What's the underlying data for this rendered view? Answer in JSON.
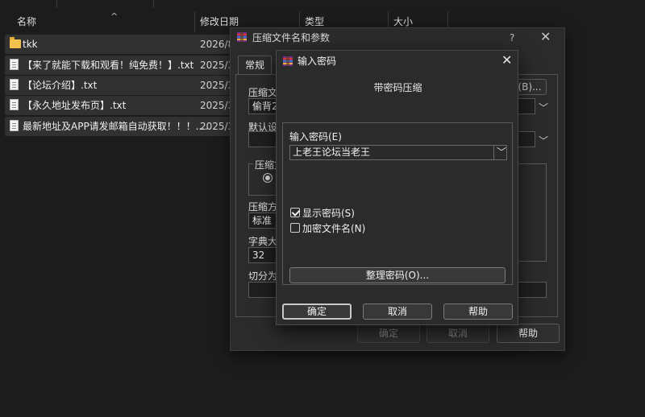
{
  "explorer": {
    "columns": {
      "name": "名称",
      "modified": "修改日期",
      "type": "类型",
      "size": "大小"
    },
    "sort_arrow": "^",
    "rows": [
      {
        "icon": "folder-icon",
        "name": "tkk",
        "date": "2026/8,"
      },
      {
        "icon": "txt-file-icon",
        "name": "【来了就能下载和观看！纯免费！】.txt",
        "date": "2025/3,"
      },
      {
        "icon": "txt-file-icon",
        "name": "【论坛介绍】.txt",
        "date": "2025/3,"
      },
      {
        "icon": "txt-file-icon",
        "name": "【永久地址发布页】.txt",
        "date": "2025/3,"
      },
      {
        "icon": "txt-file-icon",
        "name": "最新地址及APP请发邮箱自动获取！！！....",
        "date": "2025/3,"
      }
    ]
  },
  "archive_dialog": {
    "title": "压缩文件名和参数",
    "icon": "winrar-icon",
    "help_symbol": "?",
    "close_symbol": "✕",
    "tab_general": "常规",
    "archive_label": "压缩文",
    "archive_value": "偷背2",
    "browse_label": "(B)...",
    "default_label": "默认设",
    "format_label": "压缩文",
    "method_label": "压缩方",
    "method_value": "标准",
    "dict_label": "字典大",
    "dict_value": "32",
    "split_label": "切分为",
    "ok": "确定",
    "cancel": "取消",
    "help": "帮助"
  },
  "password_dialog": {
    "title": "输入密码",
    "icon": "winrar-icon",
    "close_symbol": "✕",
    "subtitle": "带密码压缩",
    "password_label": "输入密码(E)",
    "password_value": "上老王论坛当老王",
    "show_password": {
      "label": "显示密码(S)",
      "checked": true
    },
    "encrypt_filenames": {
      "label": "加密文件名(N)",
      "checked": false
    },
    "organize_button": "整理密码(O)...",
    "ok": "确定",
    "cancel": "取消",
    "help": "帮助"
  }
}
